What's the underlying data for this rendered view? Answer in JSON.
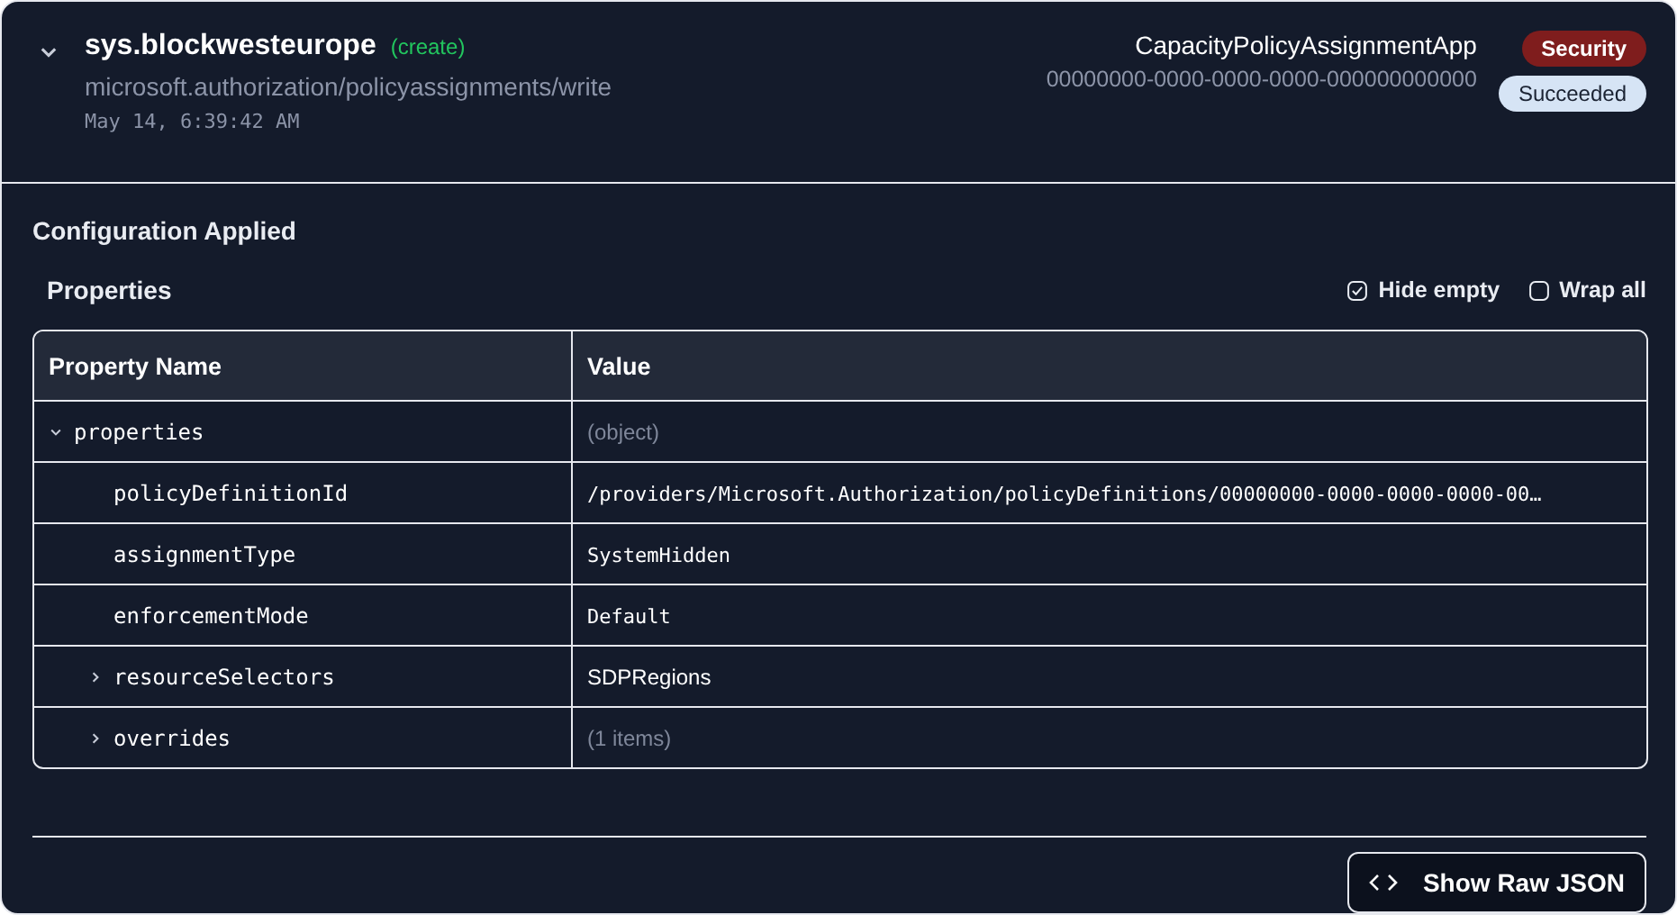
{
  "header": {
    "expanded": true,
    "title": "sys.blockwesteurope",
    "action": "(create)",
    "operation": "microsoft.authorization/policyassignments/write",
    "timestamp": "May 14, 6:39:42 AM",
    "app_name": "CapacityPolicyAssignmentApp",
    "app_id": "00000000-0000-0000-0000-000000000000",
    "badges": [
      {
        "label": "Security",
        "kind": "danger"
      },
      {
        "label": "Succeeded",
        "kind": "info"
      }
    ]
  },
  "section_title": "Configuration Applied",
  "properties": {
    "title": "Properties",
    "options": [
      {
        "label": "Hide empty",
        "checked": true
      },
      {
        "label": "Wrap all",
        "checked": false
      }
    ],
    "columns": [
      "Property Name",
      "Value"
    ],
    "rows": [
      {
        "name": "properties",
        "value": "(object)",
        "kind": "summary",
        "expanded": true,
        "children": [
          {
            "name": "policyDefinitionId",
            "value": "/providers/Microsoft.Authorization/policyDefinitions/00000000-0000-0000-0000-00…",
            "kind": "code"
          },
          {
            "name": "assignmentType",
            "value": "SystemHidden",
            "kind": "code"
          },
          {
            "name": "enforcementMode",
            "value": "Default",
            "kind": "code"
          },
          {
            "name": "resourceSelectors",
            "value": "SDPRegions",
            "kind": "text",
            "expanded": false
          },
          {
            "name": "overrides",
            "value": "(1 items)",
            "kind": "summary",
            "expanded": false
          }
        ]
      }
    ]
  },
  "raw_button": "Show Raw JSON"
}
